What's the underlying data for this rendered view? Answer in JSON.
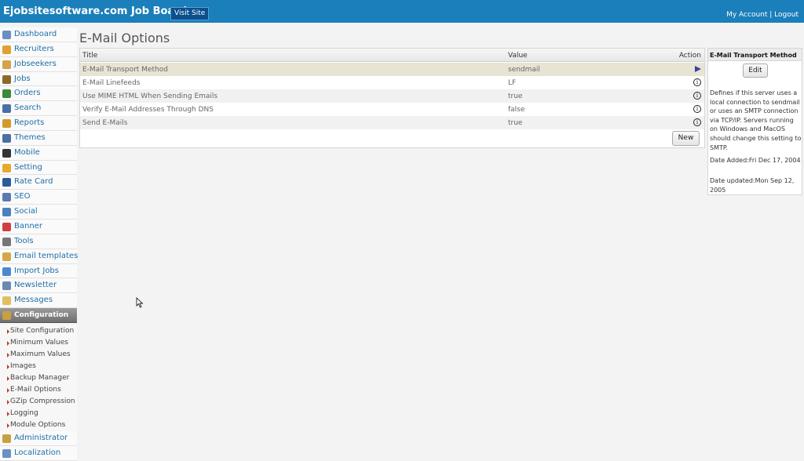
{
  "header": {
    "brand": "Ejobsitesoftware.com Job Board",
    "visit_site": "Visit Site",
    "my_account": "My Account",
    "separator": " | ",
    "logout": "Logout"
  },
  "sidebar": {
    "items": [
      {
        "label": "Dashboard",
        "icon": "home-icon",
        "color": "#6a8fc4"
      },
      {
        "label": "Recruiters",
        "icon": "person-icon",
        "color": "#e0a030"
      },
      {
        "label": "Jobseekers",
        "icon": "people-icon",
        "color": "#d6a24a"
      },
      {
        "label": "Jobs",
        "icon": "briefcase-icon",
        "color": "#8a6a2a"
      },
      {
        "label": "Orders",
        "icon": "orders-icon",
        "color": "#3a8a3a"
      },
      {
        "label": "Search",
        "icon": "magnifier-icon",
        "color": "#4a6fa5"
      },
      {
        "label": "Reports",
        "icon": "book-icon",
        "color": "#d49a2a"
      },
      {
        "label": "Themes",
        "icon": "grid-icon",
        "color": "#4a6fa5"
      },
      {
        "label": "Mobile",
        "icon": "phone-icon",
        "color": "#333333"
      },
      {
        "label": "Setting",
        "icon": "gear-icon",
        "color": "#e8a830"
      },
      {
        "label": "Rate Card",
        "icon": "dollar-icon",
        "color": "#2a5a9a"
      },
      {
        "label": "SEO",
        "icon": "bar-chart-icon",
        "color": "#5a7ab0"
      },
      {
        "label": "Social",
        "icon": "globe-icon",
        "color": "#4a7fc0"
      },
      {
        "label": "Banner",
        "icon": "banner-icon",
        "color": "#d04040"
      },
      {
        "label": "Tools",
        "icon": "tools-icon",
        "color": "#777777"
      },
      {
        "label": "Email templates",
        "icon": "envelope-icon",
        "color": "#d4a84a"
      },
      {
        "label": "Import Jobs",
        "icon": "import-icon",
        "color": "#4a8ad0"
      },
      {
        "label": "Newsletter",
        "icon": "newsletter-icon",
        "color": "#6a8ab0"
      },
      {
        "label": "Messages",
        "icon": "mail-icon",
        "color": "#e0c060"
      }
    ],
    "active": {
      "label": "Configuration",
      "icon": "configuration-icon",
      "color": "#c8a040"
    },
    "sub_items": [
      "Site Configuration",
      "Minimum Values",
      "Maximum Values",
      "Images",
      "Backup Manager",
      "E-Mail Options",
      "GZip Compression",
      "Logging",
      "Module Options"
    ],
    "after": [
      {
        "label": "Administrator",
        "icon": "lock-icon",
        "color": "#c8a040"
      },
      {
        "label": "Localization",
        "icon": "localization-icon",
        "color": "#6a8fc4"
      }
    ]
  },
  "main": {
    "title": "E-Mail Options",
    "columns": {
      "title": "Title",
      "value": "Value",
      "action": "Action"
    },
    "rows": [
      {
        "title": "E-Mail Transport Method",
        "value": "sendmail",
        "action_icon": "play-icon",
        "selected": true
      },
      {
        "title": "E-Mail Linefeeds",
        "value": "LF",
        "action_icon": "info-icon"
      },
      {
        "title": "Use MIME HTML When Sending Emails",
        "value": "true",
        "action_icon": "info-icon"
      },
      {
        "title": "Verify E-Mail Addresses Through DNS",
        "value": "false",
        "action_icon": "info-icon"
      },
      {
        "title": "Send E-Mails",
        "value": "true",
        "action_icon": "info-icon"
      }
    ],
    "new_button": "New"
  },
  "detail": {
    "heading": "E-Mail Transport Method",
    "edit_button": "Edit",
    "description": "Defines if this server uses a local connection to sendmail or uses an SMTP connection via TCP/IP. Servers running on Windows and MacOS should change this setting to SMTP.",
    "date_added": "Date Added:Fri Dec 17, 2004",
    "date_updated": "Date updated:Mon Sep 12, 2005"
  },
  "colors": {
    "header_bg": "#1a7fba",
    "link": "#1e6fa8",
    "selected_row": "#e8e4d4"
  }
}
